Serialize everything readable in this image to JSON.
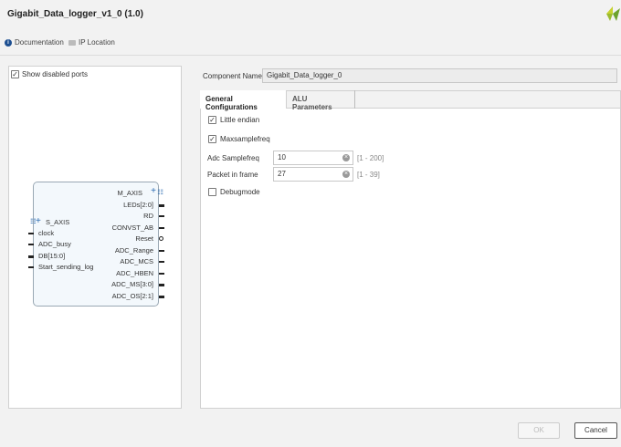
{
  "window": {
    "title": "Gigabit_Data_logger_v1_0 (1.0)"
  },
  "toolbar": {
    "documentation": "Documentation",
    "ip_location": "IP Location"
  },
  "left_panel": {
    "show_disabled_ports": "Show disabled ports",
    "show_disabled_checked": true
  },
  "block": {
    "inputs": [
      "S_AXIS",
      "clock",
      "ADC_busy",
      "DB[15:0]",
      "Start_sending_log"
    ],
    "outputs": [
      "M_AXIS",
      "LEDs[2:0]",
      "RD",
      "CONVST_AB",
      "Reset",
      "ADC_Range",
      "ADC_MCS",
      "ADC_HBEN",
      "ADC_MS[3:0]",
      "ADC_OS[2:1]"
    ]
  },
  "component": {
    "label": "Component Name",
    "value": "Gigabit_Data_logger_0"
  },
  "tabs": [
    {
      "label": "General Configurations",
      "active": true
    },
    {
      "label": "ALU Parameters",
      "active": false
    }
  ],
  "general": {
    "little_endian": {
      "label": "Little endian",
      "checked": true
    },
    "maxsamplefreq": {
      "label": "Maxsamplefreq",
      "checked": true
    },
    "adc_samplefreq": {
      "label": "Adc Samplefreq",
      "value": "10",
      "range": "[1 - 200]"
    },
    "packet_in_frame": {
      "label": "Packet in frame",
      "value": "27",
      "range": "[1 - 39]"
    },
    "debugmode": {
      "label": "Debugmode",
      "checked": false
    }
  },
  "buttons": {
    "ok": "OK",
    "cancel": "Cancel"
  }
}
